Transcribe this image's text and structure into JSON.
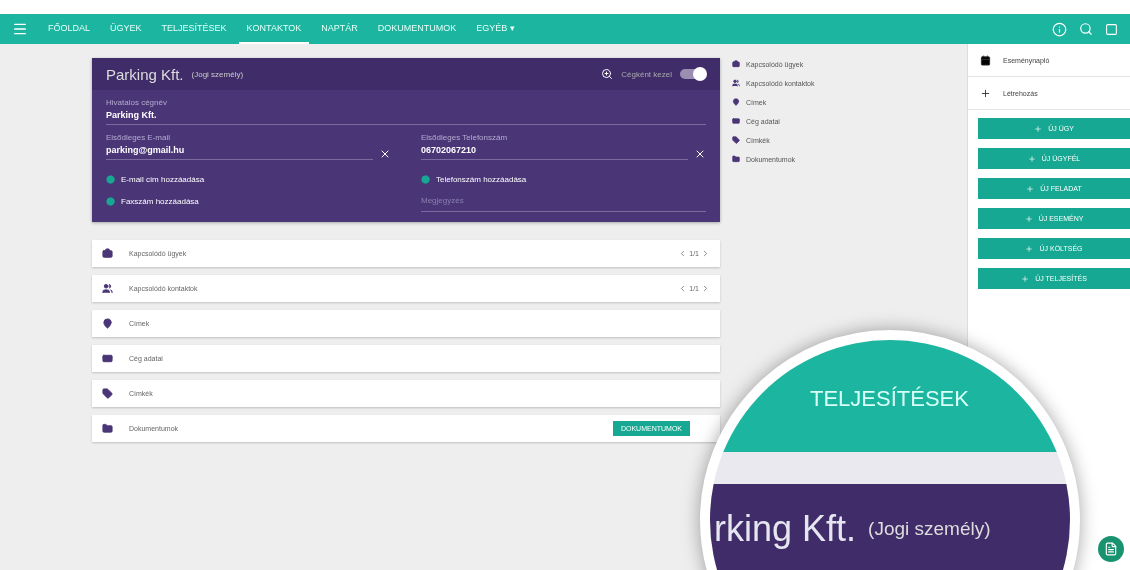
{
  "nav": {
    "items": [
      {
        "label": "FŐOLDAL",
        "selected": false
      },
      {
        "label": "ÜGYEK",
        "selected": false
      },
      {
        "label": "TELJESÍTÉSEK",
        "selected": false
      },
      {
        "label": "KONTAKTOK",
        "selected": true
      },
      {
        "label": "NAPTÁR",
        "selected": false
      },
      {
        "label": "DOKUMENTUMOK",
        "selected": false
      },
      {
        "label": "EGYÉB ▾",
        "selected": false
      }
    ]
  },
  "contact": {
    "name": "Parking Kft.",
    "type": "(Jogi személy)",
    "toggle_label": "Cégként kezel",
    "toggle_on": true,
    "fields": [
      {
        "label": "Hivatalos cégnév",
        "value": "Parking Kft."
      },
      {
        "label": "Elsődleges E-mail",
        "value": "parking@gmail.hu"
      },
      {
        "label": "Elsődleges Telefonszám",
        "value": "06702067210"
      }
    ],
    "add_links": [
      "E-mail cím hozzáadása",
      "Telefonszám hozzáadása",
      "Faxszám hozzáadása"
    ],
    "note": {
      "placeholder": "Megjegyzés"
    }
  },
  "sections": [
    {
      "label": "Kapcsolódó ügyek",
      "kind": "pager",
      "pager": "1/1"
    },
    {
      "label": "Kapcsolódó kontaktok",
      "kind": "pager",
      "pager": "1/1"
    },
    {
      "label": "Címek",
      "kind": "plain"
    },
    {
      "label": "Cég adatai",
      "kind": "plain"
    },
    {
      "label": "Címkék",
      "kind": "plain"
    },
    {
      "label": "Dokumentumok",
      "kind": "action",
      "action": "DOKUMENTUMOK"
    }
  ],
  "quick_links": [
    "Kapcsolódó ügyek",
    "Kapcsolódó kontaktok",
    "Címek",
    "Cég adatai",
    "Címkék",
    "Dokumentumok"
  ],
  "right_panel": {
    "items": [
      "Eseménynapló",
      "Létrehozás"
    ],
    "buttons": [
      "ÚJ ÜGY",
      "ÚJ ÜGYFÉL",
      "ÚJ FELADAT",
      "ÚJ ESEMÉNY",
      "ÚJ KÖLTSÉG",
      "ÚJ TELJESÍTÉS"
    ]
  },
  "magnifier": {
    "nav_text": "TELJESÍTÉSEK",
    "name": "rking Kft.",
    "type": "(Jogi személy)"
  }
}
